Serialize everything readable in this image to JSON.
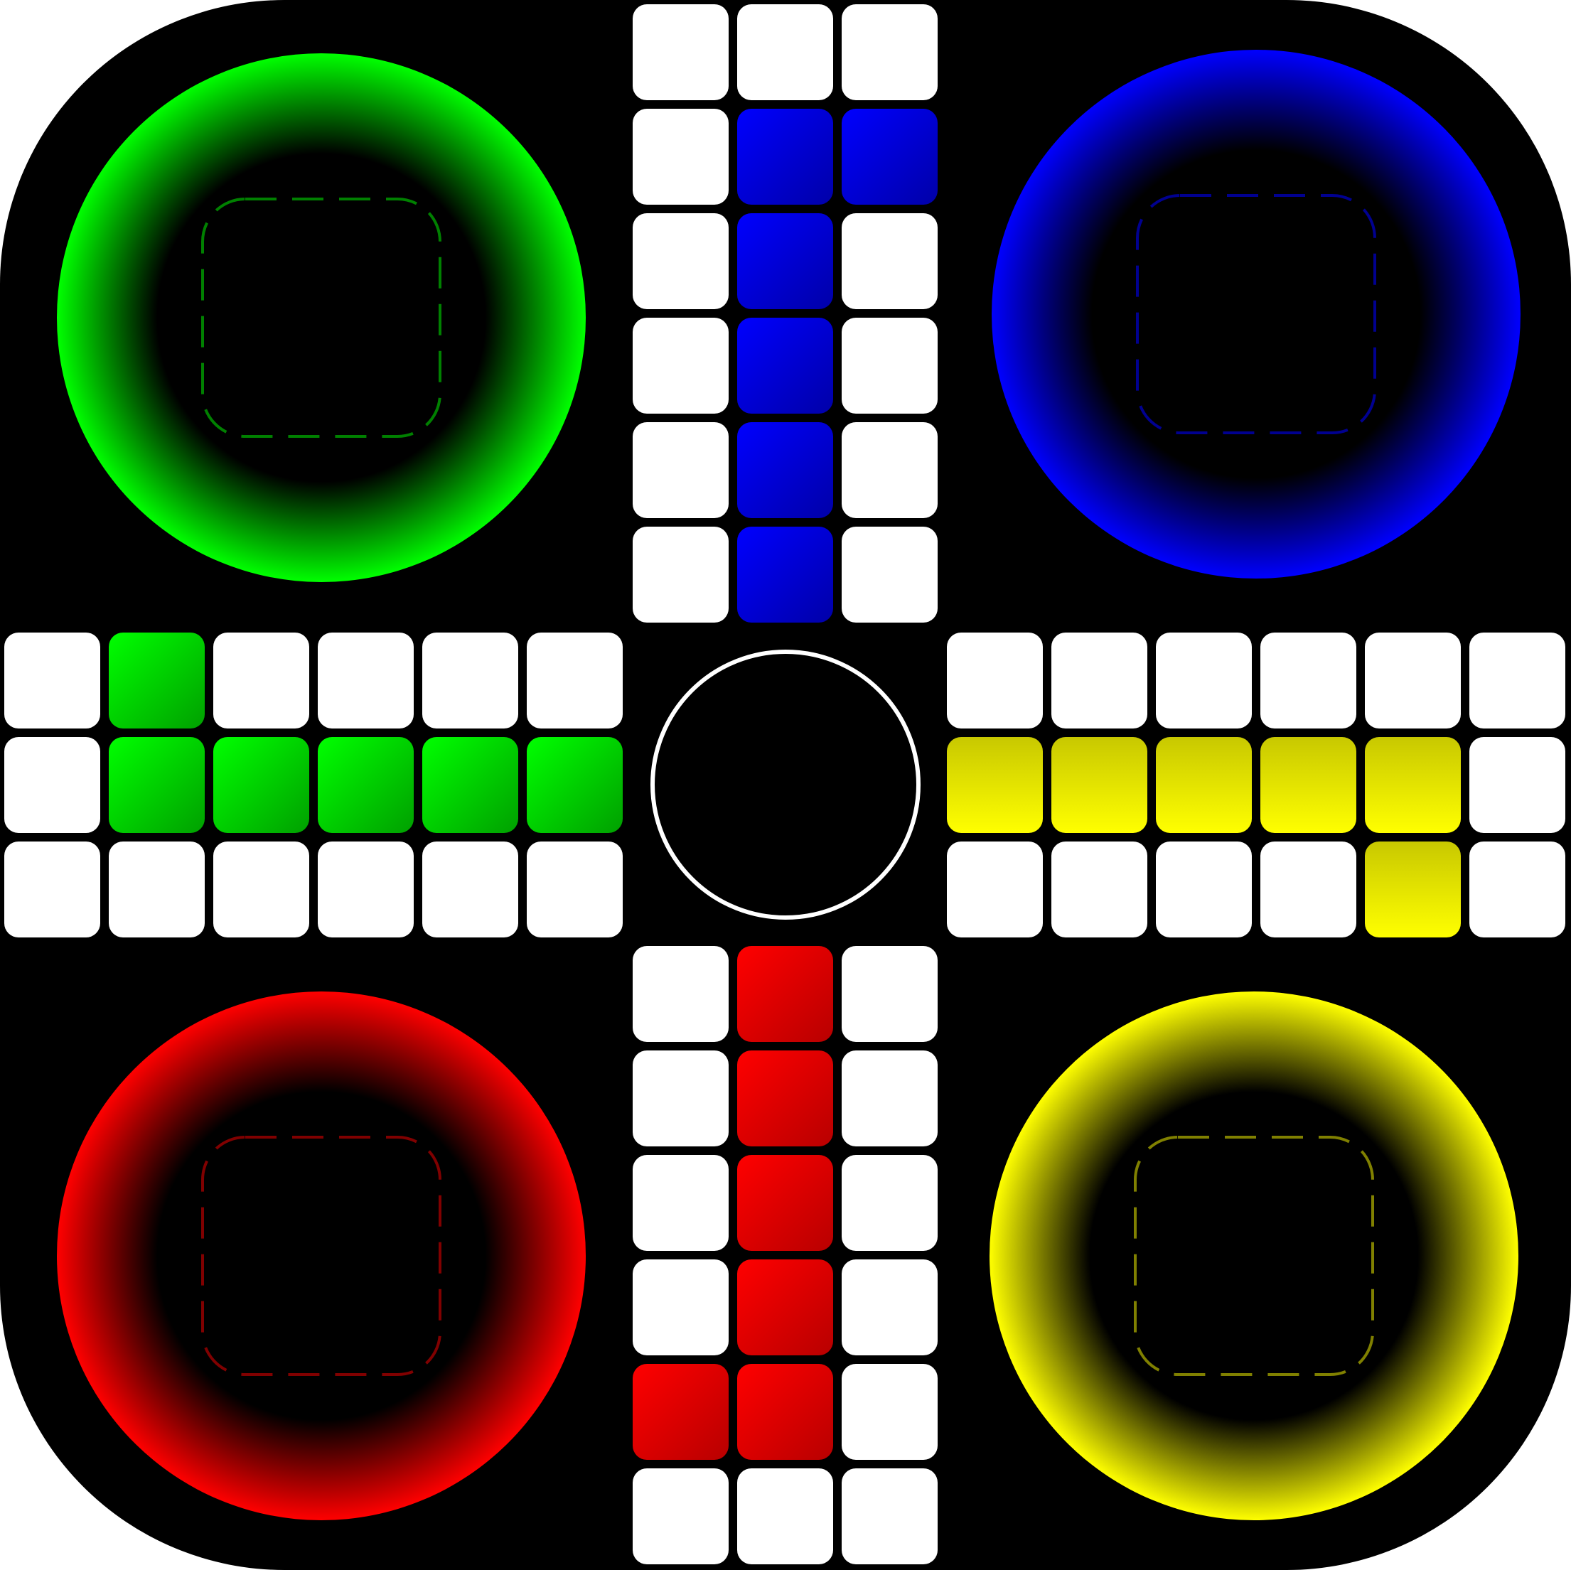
{
  "board": {
    "background_color": "#000000",
    "cell_color": "#ffffff",
    "center_ring_color": "#ffffff"
  },
  "players": [
    {
      "id": "green",
      "quadrant": "top-left",
      "color": "#00ff00",
      "dark": "#00a000",
      "nest_line": "#008000",
      "nest_label": "green-home"
    },
    {
      "id": "blue",
      "quadrant": "top-right",
      "color": "#0000ff",
      "dark": "#0000a8",
      "nest_line": "#000090",
      "nest_label": "blue-home"
    },
    {
      "id": "red",
      "quadrant": "bottom-left",
      "color": "#ff0000",
      "dark": "#b80000",
      "nest_line": "#800000",
      "nest_label": "red-home"
    },
    {
      "id": "yellow",
      "quadrant": "bottom-right",
      "color": "#ffff00",
      "dark": "#c8c800",
      "nest_line": "#808000",
      "nest_label": "yellow-home"
    }
  ],
  "tracks": {
    "top": {
      "cols": 3,
      "rows": 6,
      "colored": [
        [
          1,
          1,
          "blue"
        ],
        [
          1,
          2,
          "blue"
        ],
        [
          1,
          3,
          "blue"
        ],
        [
          1,
          4,
          "blue"
        ],
        [
          1,
          5,
          "blue"
        ],
        [
          2,
          1,
          "blue"
        ]
      ]
    },
    "bottom": {
      "cols": 3,
      "rows": 6,
      "colored": [
        [
          1,
          0,
          "red"
        ],
        [
          1,
          1,
          "red"
        ],
        [
          1,
          2,
          "red"
        ],
        [
          1,
          3,
          "red"
        ],
        [
          1,
          4,
          "red"
        ],
        [
          0,
          4,
          "red"
        ]
      ]
    },
    "left": {
      "cols": 6,
      "rows": 3,
      "colored": [
        [
          1,
          0,
          "green"
        ],
        [
          1,
          1,
          "green"
        ],
        [
          2,
          1,
          "green"
        ],
        [
          3,
          1,
          "green"
        ],
        [
          4,
          1,
          "green"
        ],
        [
          5,
          1,
          "green"
        ]
      ]
    },
    "right": {
      "cols": 6,
      "rows": 3,
      "colored": [
        [
          0,
          1,
          "yellow"
        ],
        [
          1,
          1,
          "yellow"
        ],
        [
          2,
          1,
          "yellow"
        ],
        [
          3,
          1,
          "yellow"
        ],
        [
          4,
          1,
          "yellow"
        ],
        [
          4,
          2,
          "yellow"
        ]
      ]
    }
  }
}
